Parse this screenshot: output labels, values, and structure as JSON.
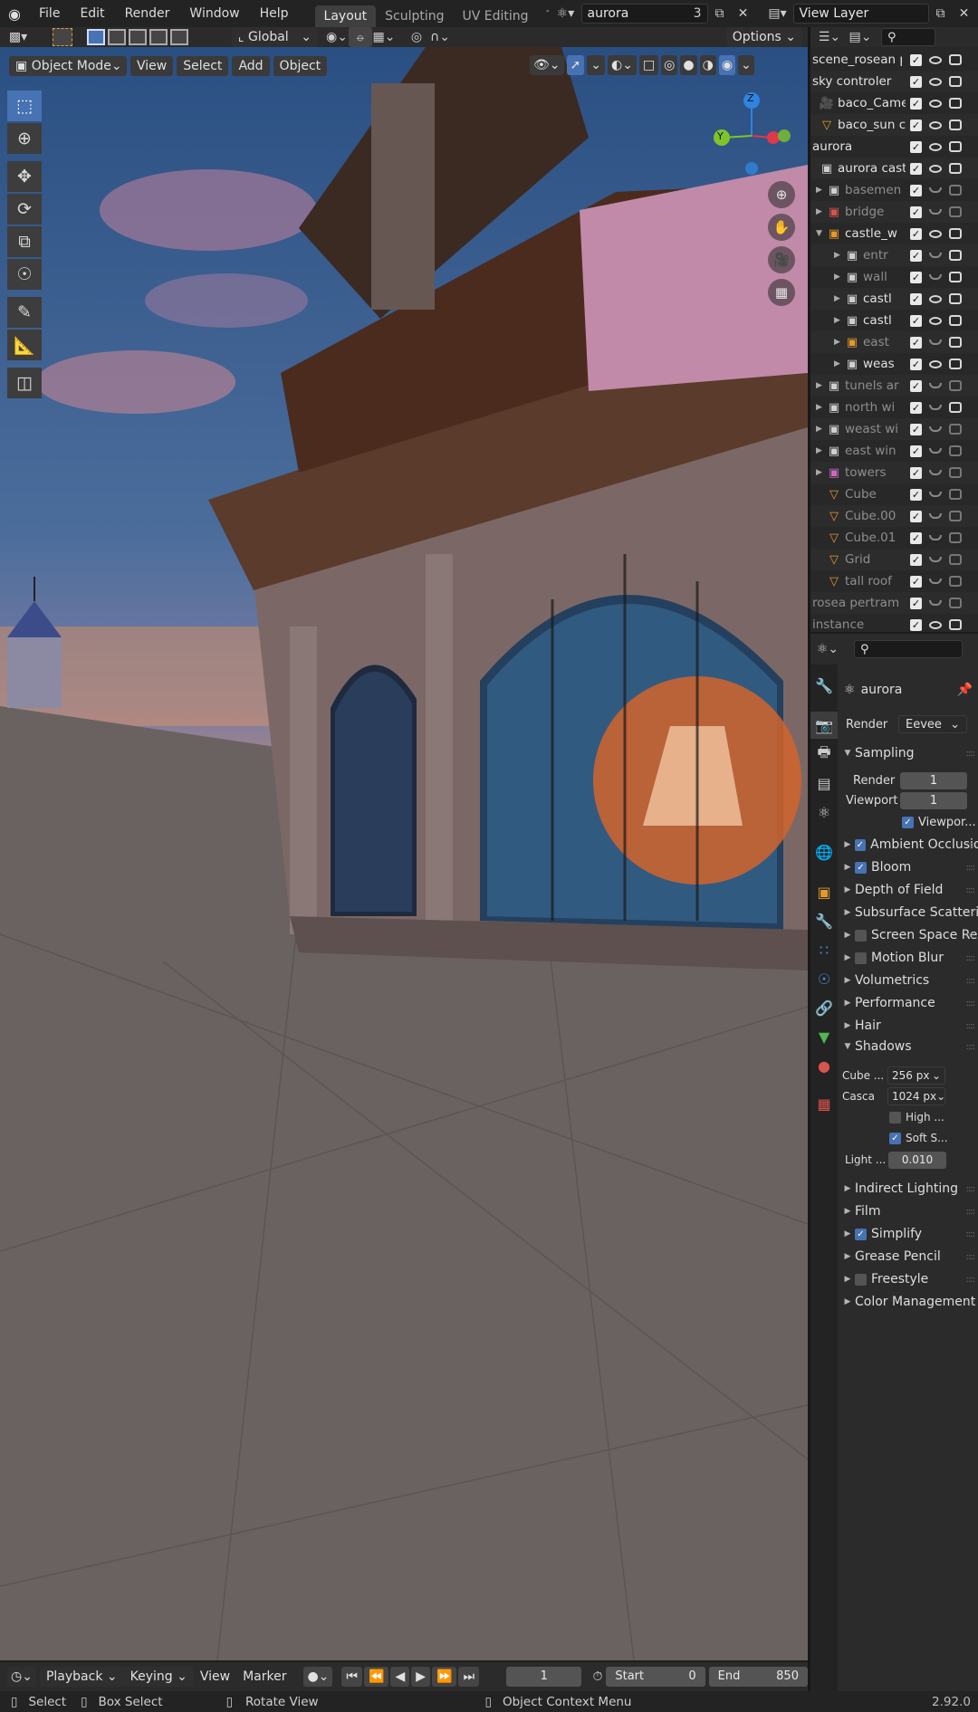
{
  "menubar": {
    "file": "File",
    "edit": "Edit",
    "render": "Render",
    "window": "Window",
    "help": "Help",
    "workspaces": [
      "Layout",
      "Sculpting",
      "UV Editing",
      "Te"
    ],
    "scene_name": "aurora",
    "scene_users": "3",
    "view_layer": "View Layer"
  },
  "header": {
    "orientation": "Global",
    "options": "Options"
  },
  "viewport_header": {
    "mode": "Object Mode",
    "view": "View",
    "select": "Select",
    "add": "Add",
    "object": "Object"
  },
  "gizmo": {
    "z": "Z",
    "y": "Y"
  },
  "outliner": {
    "rows": [
      {
        "name": "scene_rosean pe",
        "indent": 0,
        "icon": "none",
        "muted": false,
        "eye": true,
        "cam": true
      },
      {
        "name": "sky controler",
        "indent": 0,
        "icon": "none",
        "muted": false,
        "eye": true,
        "cam": true
      },
      {
        "name": "baco_Camer",
        "indent": 1,
        "icon": "camera",
        "muted": false,
        "eye": true,
        "cam": true
      },
      {
        "name": "baco_sun co",
        "indent": 1,
        "icon": "mesh",
        "muted": false,
        "eye": true,
        "cam": true
      },
      {
        "name": "aurora",
        "indent": 0,
        "icon": "none",
        "muted": false,
        "eye": true,
        "cam": true
      },
      {
        "name": "aurora castl",
        "indent": 1,
        "icon": "collection",
        "muted": false,
        "eye": true,
        "cam": true
      },
      {
        "name": "basemen",
        "indent": 2,
        "icon": "collection",
        "muted": true,
        "eye": false,
        "cam": false
      },
      {
        "name": "bridge",
        "indent": 2,
        "icon": "collection-red",
        "muted": true,
        "eye": false,
        "cam": false
      },
      {
        "name": "castle_w",
        "indent": 2,
        "icon": "collection-orange",
        "muted": false,
        "eye": true,
        "cam": true
      },
      {
        "name": "entr",
        "indent": 3,
        "icon": "collection",
        "muted": true,
        "eye": false,
        "cam": true
      },
      {
        "name": "wall",
        "indent": 3,
        "icon": "collection",
        "muted": true,
        "eye": false,
        "cam": true
      },
      {
        "name": "castl",
        "indent": 3,
        "icon": "collection",
        "muted": false,
        "eye": true,
        "cam": true
      },
      {
        "name": "castl",
        "indent": 3,
        "icon": "collection",
        "muted": false,
        "eye": true,
        "cam": true
      },
      {
        "name": "east",
        "indent": 3,
        "icon": "collection-orange",
        "muted": true,
        "eye": false,
        "cam": true
      },
      {
        "name": "weas",
        "indent": 3,
        "icon": "collection",
        "muted": false,
        "eye": true,
        "cam": true
      },
      {
        "name": "tunels ar",
        "indent": 2,
        "icon": "collection",
        "muted": true,
        "eye": false,
        "cam": false
      },
      {
        "name": "north wi",
        "indent": 2,
        "icon": "collection",
        "muted": true,
        "eye": false,
        "cam": true
      },
      {
        "name": "weast wi",
        "indent": 2,
        "icon": "collection",
        "muted": true,
        "eye": false,
        "cam": false
      },
      {
        "name": "east win",
        "indent": 2,
        "icon": "collection",
        "muted": true,
        "eye": false,
        "cam": false
      },
      {
        "name": "towers",
        "indent": 2,
        "icon": "collection-pink",
        "muted": true,
        "eye": false,
        "cam": false
      },
      {
        "name": "Cube",
        "indent": 2,
        "icon": "mesh",
        "muted": true,
        "eye": false,
        "cam": false
      },
      {
        "name": "Cube.00",
        "indent": 2,
        "icon": "mesh",
        "muted": true,
        "eye": false,
        "cam": false
      },
      {
        "name": "Cube.01",
        "indent": 2,
        "icon": "mesh",
        "muted": true,
        "eye": false,
        "cam": false
      },
      {
        "name": "Grid",
        "indent": 2,
        "icon": "mesh",
        "muted": true,
        "eye": false,
        "cam": false
      },
      {
        "name": "tall roof",
        "indent": 2,
        "icon": "mesh",
        "muted": true,
        "eye": false,
        "cam": false
      },
      {
        "name": "rosea pertram",
        "indent": 0,
        "icon": "none",
        "muted": true,
        "eye": false,
        "cam": false
      },
      {
        "name": "instance",
        "indent": 0,
        "icon": "none",
        "muted": true,
        "eye": true,
        "cam": true
      }
    ]
  },
  "properties": {
    "scene_name": "aurora",
    "render_label": "Render",
    "render_engine": "Eevee",
    "sampling": "Sampling",
    "sampling_render_label": "Render",
    "sampling_render_value": "1",
    "sampling_viewport_label": "Viewport",
    "sampling_viewport_value": "1",
    "viewport_denoise": "Viewpor...",
    "sections": [
      {
        "label": "Ambient Occlusio",
        "check": true
      },
      {
        "label": "Bloom",
        "check": true
      },
      {
        "label": "Depth of Field",
        "check": null
      },
      {
        "label": "Subsurface Scatteri",
        "check": null
      },
      {
        "label": "Screen Space Re",
        "check": false
      },
      {
        "label": "Motion Blur",
        "check": false
      },
      {
        "label": "Volumetrics",
        "check": null
      },
      {
        "label": "Performance",
        "check": null
      },
      {
        "label": "Hair",
        "check": null
      }
    ],
    "shadows": "Shadows",
    "cube_label": "Cube ...",
    "cube_value": "256 px",
    "cascade_label": "Casca",
    "cascade_value": "1024 px",
    "high_bitdepth": "High ...",
    "soft_shadows": "Soft S...",
    "light_label": "Light ...",
    "light_value": "0.010",
    "sections2": [
      {
        "label": "Indirect Lighting",
        "check": null
      },
      {
        "label": "Film",
        "check": null
      },
      {
        "label": "Simplify",
        "check": true
      },
      {
        "label": "Grease Pencil",
        "check": null
      },
      {
        "label": "Freestyle",
        "check": false
      },
      {
        "label": "Color Management",
        "check": null
      }
    ]
  },
  "timeline": {
    "playback": "Playback",
    "keying": "Keying",
    "view": "View",
    "marker": "Marker",
    "current_frame": "1",
    "start_label": "Start",
    "start_value": "0",
    "end_label": "End",
    "end_value": "850"
  },
  "statusbar": {
    "select": "Select",
    "box_select": "Box Select",
    "rotate_view": "Rotate View",
    "context_menu": "Object Context Menu",
    "version": "2.92.0"
  }
}
